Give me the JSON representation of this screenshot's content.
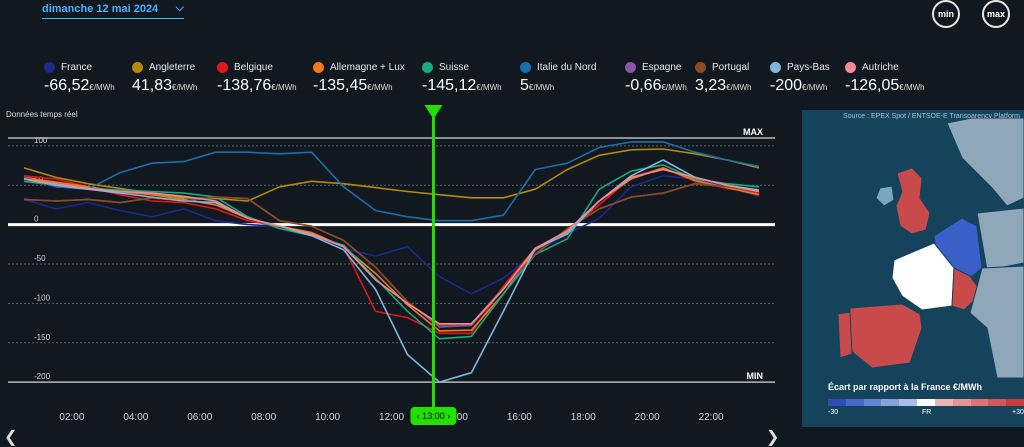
{
  "header": {
    "date": "dimanche 12 mai 2024",
    "min_label": "min",
    "max_label": "max"
  },
  "legend": [
    {
      "name": "France",
      "value": "-66,52",
      "color": "#1b2a8a"
    },
    {
      "name": "Angleterre",
      "value": "41,83",
      "color": "#b58a0a"
    },
    {
      "name": "Belgique",
      "value": "-138,76",
      "color": "#e01818"
    },
    {
      "name": "Allemagne + Lux",
      "value": "-135,45",
      "color": "#f07a1a"
    },
    {
      "name": "Suisse",
      "value": "-145,12",
      "color": "#1aaa7e"
    },
    {
      "name": "Italie du Nord",
      "value": "5",
      "color": "#1a6faa"
    },
    {
      "name": "Espagne",
      "value": "-0,66",
      "color": "#8a55a8"
    },
    {
      "name": "Portugal",
      "value": "3,23",
      "color": "#8a4a22"
    },
    {
      "name": "Pays-Bas",
      "value": "-200",
      "color": "#7fb6dc"
    },
    {
      "name": "Autriche",
      "value": "-126,05",
      "color": "#f08a96"
    }
  ],
  "unit": "€/MWh",
  "realtime_label": "Données temps réel",
  "cursor_label": "13:00",
  "map": {
    "source": "Source : EPEX Spot / ENTSOE-E Transparency Platform",
    "title": "Écart par rapport à la France €/MWh",
    "scale_min": "-30",
    "scale_mid": "FR",
    "scale_max": "+30"
  },
  "chart_data": {
    "type": "line",
    "x": [
      0,
      1,
      2,
      3,
      4,
      5,
      6,
      7,
      8,
      9,
      10,
      11,
      12,
      13,
      14,
      15,
      16,
      17,
      18,
      19,
      20,
      21,
      22,
      23
    ],
    "xticks": [
      "02:00",
      "04:00",
      "06:00",
      "08:00",
      "10:00",
      "12:00",
      "14:00",
      "16:00",
      "18:00",
      "20:00",
      "22:00"
    ],
    "xtick_hours": [
      2,
      4,
      6,
      8,
      10,
      12,
      14,
      16,
      18,
      20,
      22
    ],
    "yticks": [
      100,
      50,
      0,
      -50,
      -100,
      -150,
      -200
    ],
    "ylim": [
      -210,
      110
    ],
    "max_label": "MAX",
    "max_value": 110,
    "min_label": "MIN",
    "min_value": -200,
    "cursor_hour": 13,
    "series": [
      {
        "name": "France",
        "color": "#1b2a8a",
        "values": [
          32,
          20,
          28,
          18,
          10,
          20,
          5,
          0,
          -2,
          -12,
          -30,
          -40,
          -28,
          -66,
          -88,
          -68,
          -35,
          -12,
          8,
          48,
          62,
          58,
          48,
          36
        ]
      },
      {
        "name": "Angleterre",
        "color": "#b58a0a",
        "values": [
          72,
          60,
          52,
          46,
          40,
          34,
          33,
          30,
          48,
          55,
          52,
          47,
          42,
          38,
          34,
          34,
          45,
          70,
          88,
          95,
          96,
          90,
          82,
          72
        ]
      },
      {
        "name": "Belgique",
        "color": "#e01818",
        "values": [
          62,
          58,
          48,
          38,
          30,
          28,
          20,
          5,
          -2,
          -12,
          -28,
          -110,
          -118,
          -138,
          -138,
          -78,
          -30,
          -8,
          25,
          60,
          72,
          55,
          46,
          40
        ]
      },
      {
        "name": "Allemagne + Lux",
        "color": "#f07a1a",
        "values": [
          60,
          54,
          48,
          42,
          38,
          32,
          25,
          8,
          -2,
          -10,
          -28,
          -62,
          -102,
          -135,
          -134,
          -88,
          -32,
          -10,
          30,
          58,
          72,
          56,
          47,
          38
        ]
      },
      {
        "name": "Suisse",
        "color": "#1aaa7e",
        "values": [
          55,
          50,
          46,
          44,
          42,
          40,
          35,
          10,
          -5,
          -14,
          -26,
          -68,
          -110,
          -145,
          -142,
          -88,
          -38,
          -18,
          45,
          68,
          76,
          58,
          52,
          48
        ]
      },
      {
        "name": "Italie du Nord",
        "color": "#1a6faa",
        "values": [
          60,
          48,
          45,
          66,
          78,
          80,
          92,
          92,
          90,
          92,
          48,
          18,
          10,
          5,
          5,
          12,
          70,
          78,
          98,
          105,
          105,
          92,
          82,
          74
        ]
      },
      {
        "name": "Espagne",
        "color": "#8a55a8",
        "values": [
          32,
          30,
          32,
          28,
          34,
          30,
          35,
          33,
          5,
          -2,
          -20,
          -54,
          -98,
          -130,
          -128,
          -82,
          -38,
          -5,
          20,
          35,
          40,
          52,
          48,
          42
        ]
      },
      {
        "name": "Portugal",
        "color": "#8a4a22",
        "values": [
          32,
          30,
          32,
          28,
          34,
          30,
          35,
          33,
          5,
          -2,
          -20,
          -54,
          -98,
          -128,
          -126,
          -80,
          -38,
          -5,
          20,
          35,
          40,
          52,
          48,
          42
        ]
      },
      {
        "name": "Pays-Bas",
        "color": "#7fb6dc",
        "values": [
          58,
          50,
          45,
          40,
          35,
          30,
          28,
          8,
          -2,
          -14,
          -32,
          -82,
          -165,
          -200,
          -188,
          -110,
          -30,
          -12,
          30,
          62,
          82,
          60,
          50,
          44
        ]
      },
      {
        "name": "Autriche",
        "color": "#f08a96",
        "values": [
          58,
          52,
          46,
          42,
          40,
          36,
          30,
          8,
          -2,
          -12,
          -28,
          -70,
          -100,
          -126,
          -126,
          -82,
          -30,
          -8,
          30,
          60,
          70,
          60,
          50,
          42
        ]
      }
    ]
  }
}
